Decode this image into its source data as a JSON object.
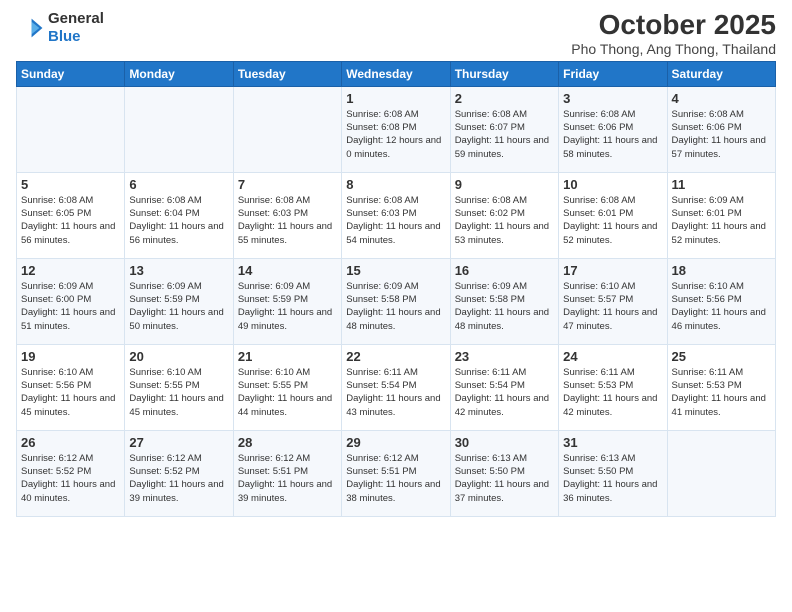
{
  "header": {
    "logo_line1": "General",
    "logo_line2": "Blue",
    "month": "October 2025",
    "location": "Pho Thong, Ang Thong, Thailand"
  },
  "weekdays": [
    "Sunday",
    "Monday",
    "Tuesday",
    "Wednesday",
    "Thursday",
    "Friday",
    "Saturday"
  ],
  "weeks": [
    [
      {
        "day": "",
        "info": ""
      },
      {
        "day": "",
        "info": ""
      },
      {
        "day": "",
        "info": ""
      },
      {
        "day": "1",
        "info": "Sunrise: 6:08 AM\nSunset: 6:08 PM\nDaylight: 12 hours\nand 0 minutes."
      },
      {
        "day": "2",
        "info": "Sunrise: 6:08 AM\nSunset: 6:07 PM\nDaylight: 11 hours\nand 59 minutes."
      },
      {
        "day": "3",
        "info": "Sunrise: 6:08 AM\nSunset: 6:06 PM\nDaylight: 11 hours\nand 58 minutes."
      },
      {
        "day": "4",
        "info": "Sunrise: 6:08 AM\nSunset: 6:06 PM\nDaylight: 11 hours\nand 57 minutes."
      }
    ],
    [
      {
        "day": "5",
        "info": "Sunrise: 6:08 AM\nSunset: 6:05 PM\nDaylight: 11 hours\nand 56 minutes."
      },
      {
        "day": "6",
        "info": "Sunrise: 6:08 AM\nSunset: 6:04 PM\nDaylight: 11 hours\nand 56 minutes."
      },
      {
        "day": "7",
        "info": "Sunrise: 6:08 AM\nSunset: 6:03 PM\nDaylight: 11 hours\nand 55 minutes."
      },
      {
        "day": "8",
        "info": "Sunrise: 6:08 AM\nSunset: 6:03 PM\nDaylight: 11 hours\nand 54 minutes."
      },
      {
        "day": "9",
        "info": "Sunrise: 6:08 AM\nSunset: 6:02 PM\nDaylight: 11 hours\nand 53 minutes."
      },
      {
        "day": "10",
        "info": "Sunrise: 6:08 AM\nSunset: 6:01 PM\nDaylight: 11 hours\nand 52 minutes."
      },
      {
        "day": "11",
        "info": "Sunrise: 6:09 AM\nSunset: 6:01 PM\nDaylight: 11 hours\nand 52 minutes."
      }
    ],
    [
      {
        "day": "12",
        "info": "Sunrise: 6:09 AM\nSunset: 6:00 PM\nDaylight: 11 hours\nand 51 minutes."
      },
      {
        "day": "13",
        "info": "Sunrise: 6:09 AM\nSunset: 5:59 PM\nDaylight: 11 hours\nand 50 minutes."
      },
      {
        "day": "14",
        "info": "Sunrise: 6:09 AM\nSunset: 5:59 PM\nDaylight: 11 hours\nand 49 minutes."
      },
      {
        "day": "15",
        "info": "Sunrise: 6:09 AM\nSunset: 5:58 PM\nDaylight: 11 hours\nand 48 minutes."
      },
      {
        "day": "16",
        "info": "Sunrise: 6:09 AM\nSunset: 5:58 PM\nDaylight: 11 hours\nand 48 minutes."
      },
      {
        "day": "17",
        "info": "Sunrise: 6:10 AM\nSunset: 5:57 PM\nDaylight: 11 hours\nand 47 minutes."
      },
      {
        "day": "18",
        "info": "Sunrise: 6:10 AM\nSunset: 5:56 PM\nDaylight: 11 hours\nand 46 minutes."
      }
    ],
    [
      {
        "day": "19",
        "info": "Sunrise: 6:10 AM\nSunset: 5:56 PM\nDaylight: 11 hours\nand 45 minutes."
      },
      {
        "day": "20",
        "info": "Sunrise: 6:10 AM\nSunset: 5:55 PM\nDaylight: 11 hours\nand 45 minutes."
      },
      {
        "day": "21",
        "info": "Sunrise: 6:10 AM\nSunset: 5:55 PM\nDaylight: 11 hours\nand 44 minutes."
      },
      {
        "day": "22",
        "info": "Sunrise: 6:11 AM\nSunset: 5:54 PM\nDaylight: 11 hours\nand 43 minutes."
      },
      {
        "day": "23",
        "info": "Sunrise: 6:11 AM\nSunset: 5:54 PM\nDaylight: 11 hours\nand 42 minutes."
      },
      {
        "day": "24",
        "info": "Sunrise: 6:11 AM\nSunset: 5:53 PM\nDaylight: 11 hours\nand 42 minutes."
      },
      {
        "day": "25",
        "info": "Sunrise: 6:11 AM\nSunset: 5:53 PM\nDaylight: 11 hours\nand 41 minutes."
      }
    ],
    [
      {
        "day": "26",
        "info": "Sunrise: 6:12 AM\nSunset: 5:52 PM\nDaylight: 11 hours\nand 40 minutes."
      },
      {
        "day": "27",
        "info": "Sunrise: 6:12 AM\nSunset: 5:52 PM\nDaylight: 11 hours\nand 39 minutes."
      },
      {
        "day": "28",
        "info": "Sunrise: 6:12 AM\nSunset: 5:51 PM\nDaylight: 11 hours\nand 39 minutes."
      },
      {
        "day": "29",
        "info": "Sunrise: 6:12 AM\nSunset: 5:51 PM\nDaylight: 11 hours\nand 38 minutes."
      },
      {
        "day": "30",
        "info": "Sunrise: 6:13 AM\nSunset: 5:50 PM\nDaylight: 11 hours\nand 37 minutes."
      },
      {
        "day": "31",
        "info": "Sunrise: 6:13 AM\nSunset: 5:50 PM\nDaylight: 11 hours\nand 36 minutes."
      },
      {
        "day": "",
        "info": ""
      }
    ]
  ]
}
